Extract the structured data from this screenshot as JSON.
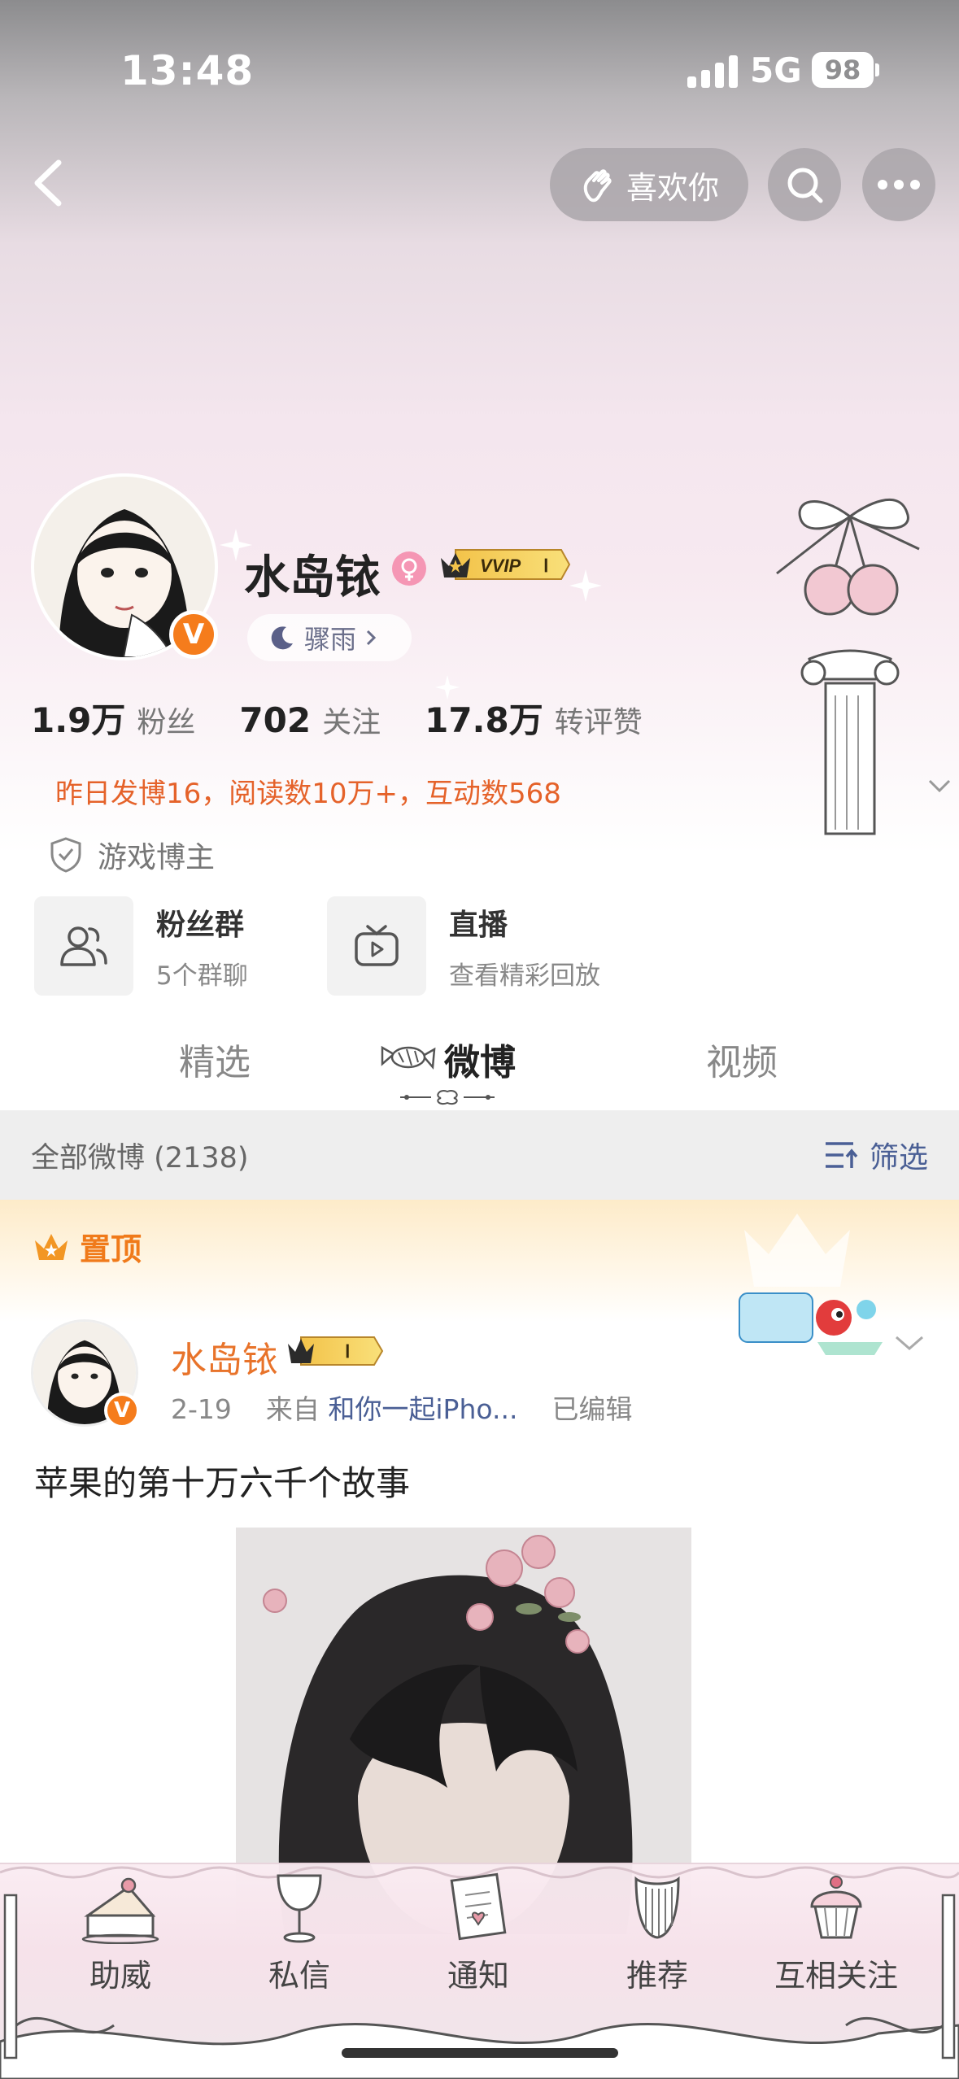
{
  "status_bar": {
    "time": "13:48",
    "network": "5G",
    "battery": "98"
  },
  "nav": {
    "like_label": "喜欢你"
  },
  "profile": {
    "name": "水岛铱",
    "badge": "VVIP",
    "badge_level": "Ⅰ",
    "mood_label": "骤雨",
    "followers_num": "1.9万",
    "followers_label": "粉丝",
    "following_num": "702",
    "following_label": "关注",
    "likes_num": "17.8万",
    "likes_label": "转评赞",
    "daily_stats": "昨日发博16，阅读数10万+，互动数568",
    "verify_label": "游戏博主"
  },
  "groups": [
    {
      "title": "粉丝群",
      "subtitle": "5个群聊"
    },
    {
      "title": "直播",
      "subtitle": "查看精彩回放"
    }
  ],
  "tabs": [
    {
      "label": "精选"
    },
    {
      "label": "微博"
    },
    {
      "label": "视频"
    }
  ],
  "filter": {
    "count_label": "全部微博 (2138)",
    "filter_label": "筛选"
  },
  "pinned": {
    "label": "置顶"
  },
  "post": {
    "author": "水岛铱",
    "date": "2-19",
    "source_prefix": "来自",
    "source": "和你一起iPho...",
    "edited": "已编辑",
    "text": "苹果的第十万六千个故事"
  },
  "bottom_nav": [
    {
      "label": "助威",
      "icon": "cake-icon"
    },
    {
      "label": "私信",
      "icon": "goblet-icon"
    },
    {
      "label": "通知",
      "icon": "letter-icon"
    },
    {
      "label": "推荐",
      "icon": "harp-icon"
    },
    {
      "label": "互相关注",
      "icon": "cupcake-icon"
    }
  ],
  "colors": {
    "accent_orange": "#e5622a",
    "link_blue": "#4a5f95",
    "verify_orange": "#f57c1c"
  }
}
